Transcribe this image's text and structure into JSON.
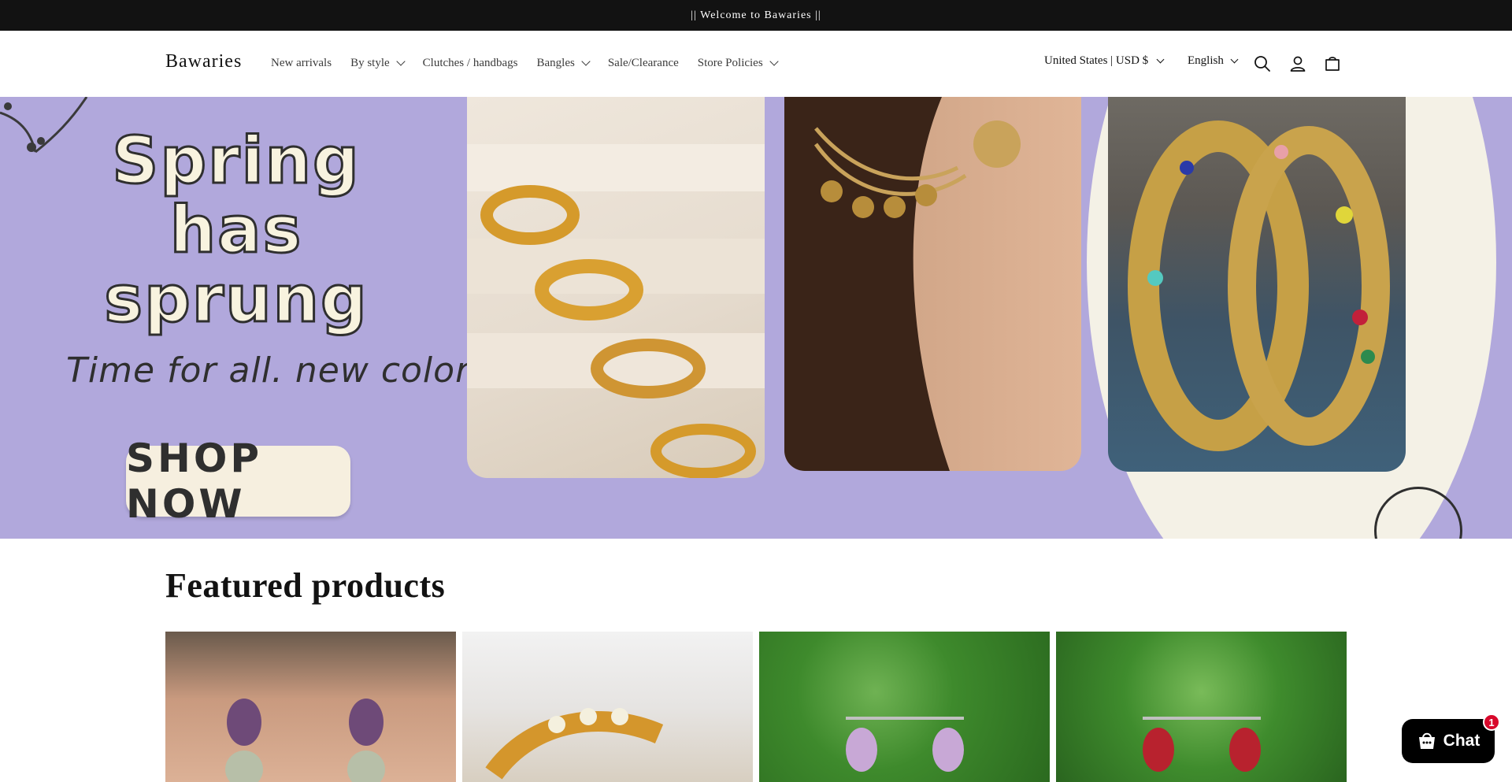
{
  "announcement": {
    "text": "|| Welcome to Bawaries ||"
  },
  "header": {
    "logo": "Bawaries",
    "nav": [
      {
        "label": "New arrivals",
        "dropdown": false
      },
      {
        "label": "By style",
        "dropdown": true
      },
      {
        "label": "Clutches / handbags",
        "dropdown": false
      },
      {
        "label": "Bangles",
        "dropdown": true
      },
      {
        "label": "Sale/Clearance",
        "dropdown": false
      },
      {
        "label": "Store Policies",
        "dropdown": true
      }
    ],
    "country_selector": "United States | USD $",
    "language_selector": "English",
    "icons": [
      "search-icon",
      "account-icon",
      "cart-icon"
    ]
  },
  "hero": {
    "headline": "Spring has sprung",
    "tagline": "Time for all. new color",
    "cta": "SHOP NOW"
  },
  "featured": {
    "title": "Featured products"
  },
  "chat": {
    "label": "Chat",
    "badge": "1"
  },
  "colors": {
    "hero_bg": "#b1a8dc",
    "announce_bg": "#121212",
    "chat_bg": "#000000",
    "badge": "#d8082b"
  }
}
